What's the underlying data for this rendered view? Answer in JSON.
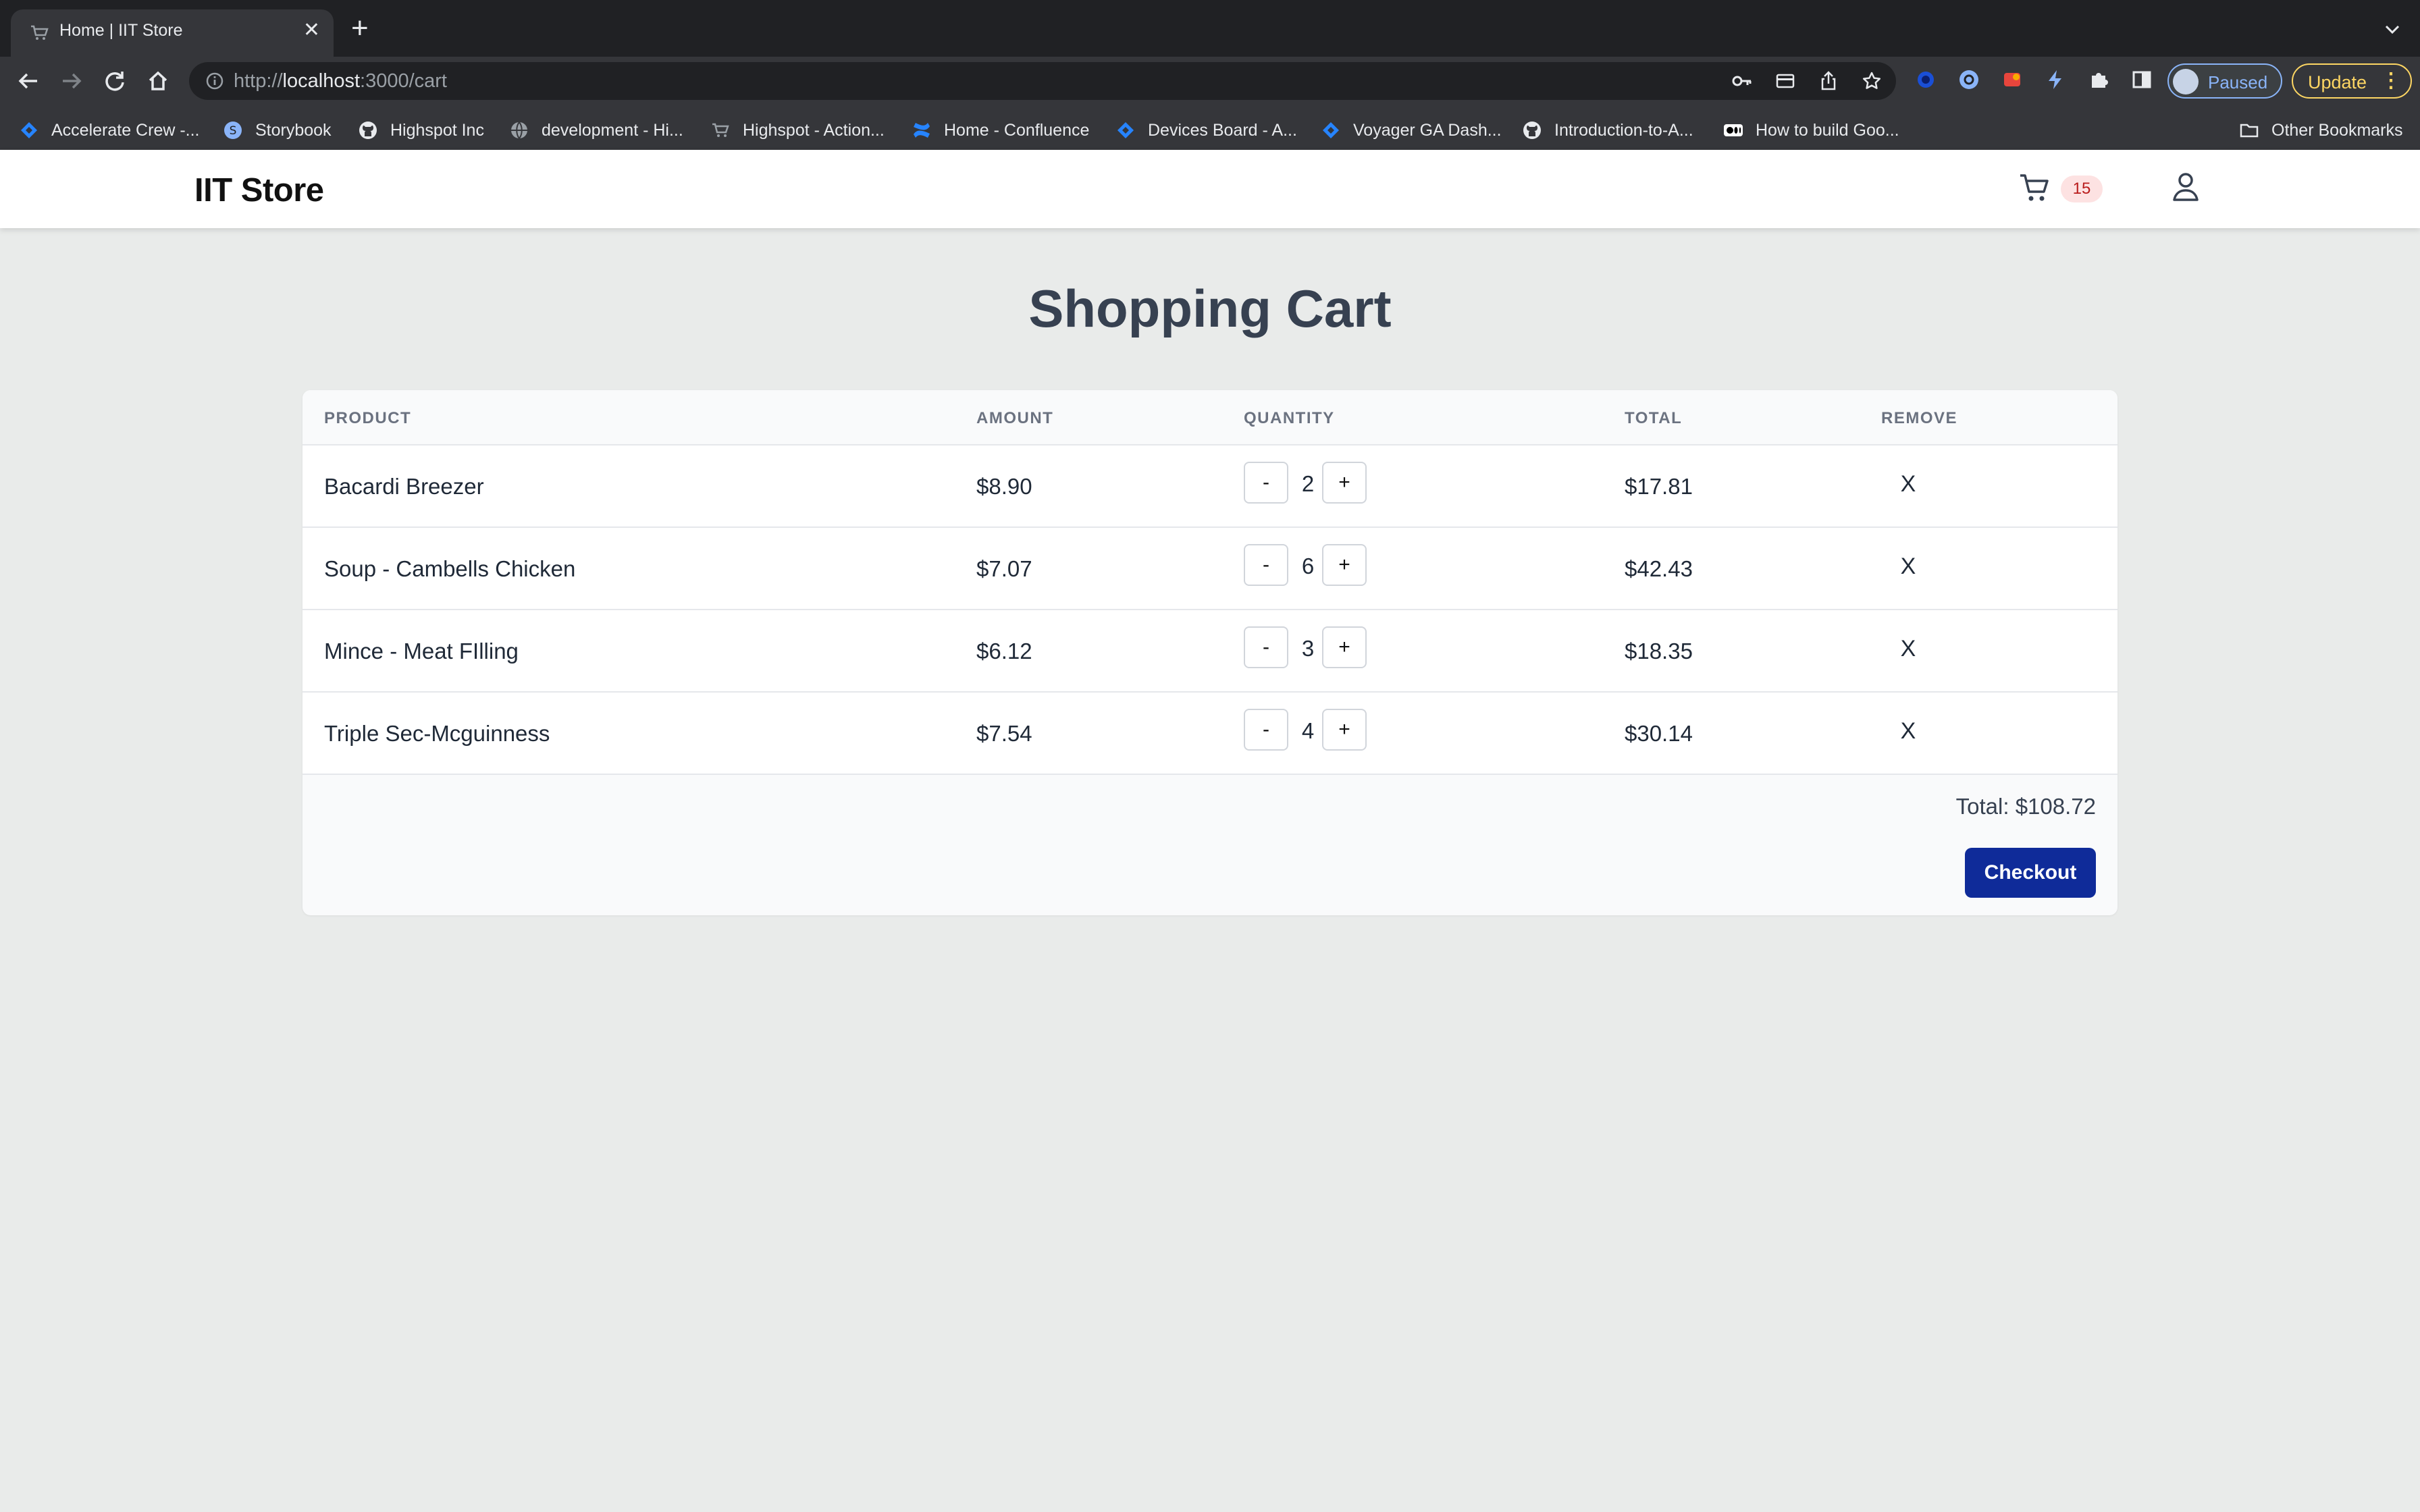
{
  "browser": {
    "tab_title": "Home | IIT Store",
    "tab_close": "✕",
    "new_tab": "+",
    "url_scheme": "http://",
    "url_host": "localhost",
    "url_path": ":3000/cart",
    "profile_status": "Paused",
    "update_label": "Update",
    "update_menu": "⋮",
    "bookmarks": [
      {
        "label": "Accelerate Crew -...",
        "icon": "jira-icon"
      },
      {
        "label": "Storybook",
        "icon": "storybook-icon"
      },
      {
        "label": "Highspot Inc",
        "icon": "github-icon"
      },
      {
        "label": "development - Hi...",
        "icon": "globe-icon"
      },
      {
        "label": "Highspot - Action...",
        "icon": "cart-icon"
      },
      {
        "label": "Home - Confluence",
        "icon": "confluence-icon"
      },
      {
        "label": "Devices Board - A...",
        "icon": "jira-icon"
      },
      {
        "label": "Voyager GA Dash...",
        "icon": "jira-icon"
      },
      {
        "label": "Introduction-to-A...",
        "icon": "github-icon"
      },
      {
        "label": "How to build Goo...",
        "icon": "medium-icon"
      }
    ],
    "other_bookmarks": "Other Bookmarks"
  },
  "header": {
    "brand": "IIT Store",
    "cart_count": "15"
  },
  "main": {
    "title": "Shopping Cart",
    "columns": [
      "PRODUCT",
      "AMOUNT",
      "QUANTITY",
      "TOTAL",
      "REMOVE"
    ],
    "decrement_label": "-",
    "increment_label": "+",
    "remove_label": "X",
    "rows": [
      {
        "product": "Bacardi Breezer",
        "amount": "$8.90",
        "quantity": "2",
        "total": "$17.81"
      },
      {
        "product": "Soup - Cambells Chicken",
        "amount": "$7.07",
        "quantity": "6",
        "total": "$42.43"
      },
      {
        "product": "Mince - Meat FIlling",
        "amount": "$6.12",
        "quantity": "3",
        "total": "$18.35"
      },
      {
        "product": "Triple Sec-Mcguinness",
        "amount": "$7.54",
        "quantity": "4",
        "total": "$30.14"
      }
    ],
    "grand_total": "Total: $108.72",
    "checkout_label": "Checkout"
  },
  "colors": {
    "checkout": "#0f2b99",
    "badge_bg": "#fde2e2",
    "badge_text": "#b91c1c",
    "page_bg": "#e9ebea"
  }
}
